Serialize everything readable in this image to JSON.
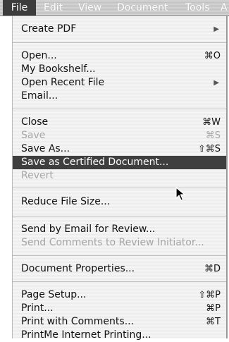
{
  "menubar": {
    "titles": [
      "File",
      "Edit",
      "View",
      "Document",
      "Tools",
      "A"
    ]
  },
  "file_menu": {
    "create_pdf": "Create PDF",
    "open": "Open...",
    "open_shortcut": "⌘O",
    "my_bookshelf": "My Bookshelf...",
    "open_recent_file": "Open Recent File",
    "email": "Email...",
    "close": "Close",
    "close_shortcut": "⌘W",
    "save": "Save",
    "save_shortcut": "⌘S",
    "save_as": "Save As...",
    "save_as_shortcut": "⇧⌘S",
    "save_certified": "Save as Certified Document...",
    "revert": "Revert",
    "reduce_file_size": "Reduce File Size...",
    "send_email_review": "Send by Email for Review...",
    "send_comments": "Send Comments to Review Initiator...",
    "document_properties": "Document Properties...",
    "document_properties_shortcut": "⌘D",
    "page_setup": "Page Setup...",
    "page_setup_shortcut": "⇧⌘P",
    "print": "Print...",
    "print_shortcut": "⌘P",
    "print_with_comments": "Print with Comments...",
    "print_with_comments_shortcut": "⌘T",
    "printme": "PrintMe Internet Printing..."
  },
  "icons": {
    "submenu": "submenu-arrow-icon",
    "pointer": "mouse-pointer-icon"
  }
}
